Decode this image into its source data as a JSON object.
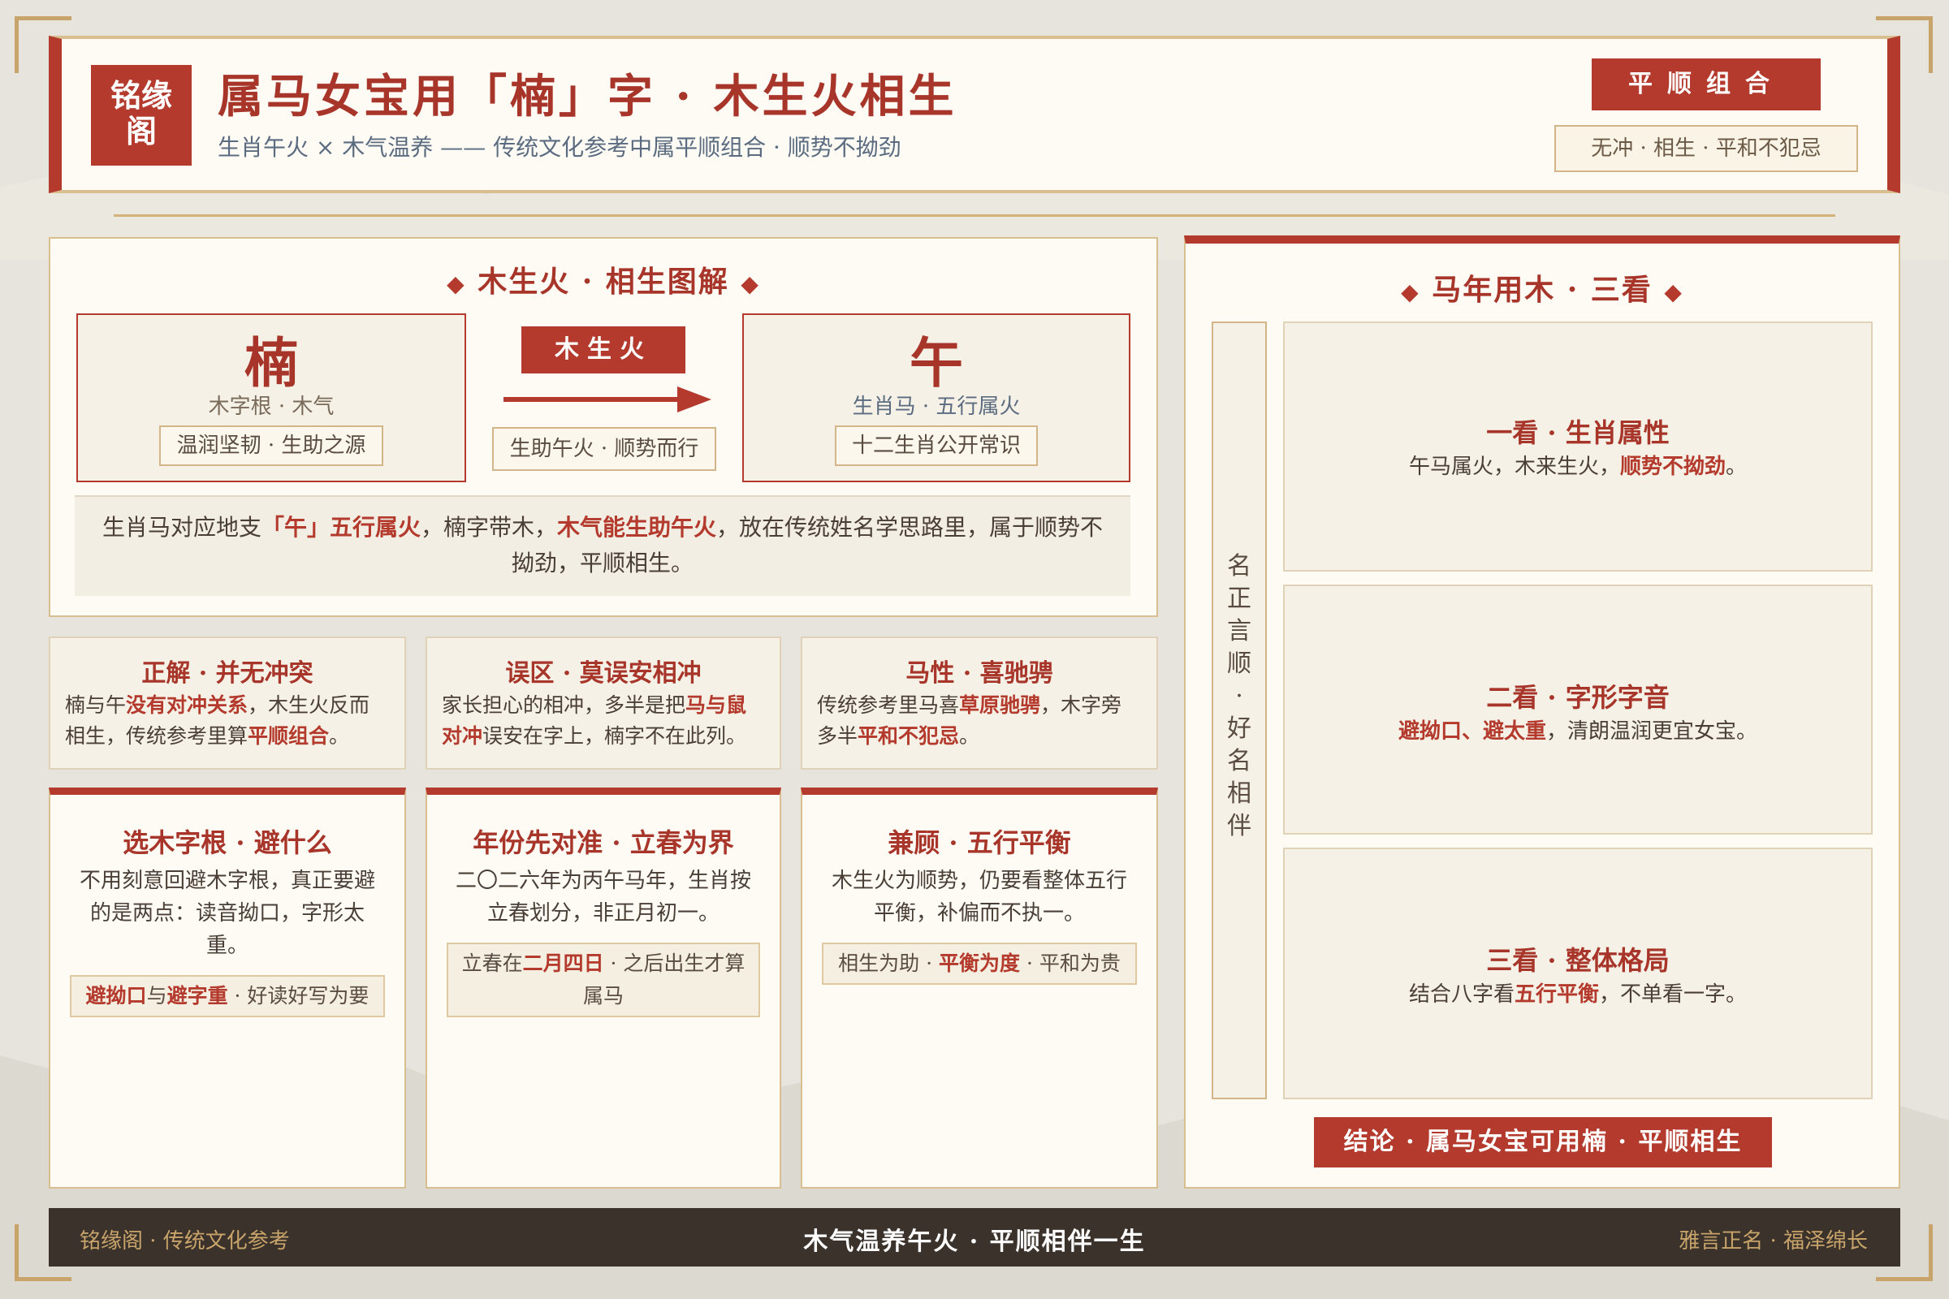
{
  "header": {
    "logo_line1": "铭缘",
    "logo_line2": "阁",
    "title": "属马女宝用「楠」字 · 木生火相生",
    "subtitle": "生肖午火 × 木气温养 —— 传统文化参考中属平顺组合 · 顺势不拗劲",
    "badge": "平顺组合",
    "tag": "无冲 · 相生 · 平和不犯忌"
  },
  "diagram": {
    "title": "木生火 · 相生图解",
    "left": {
      "char": "楠",
      "sub": "木字根 · 木气",
      "tag": "温润坚韧 · 生助之源"
    },
    "arrow": {
      "label": "木生火",
      "tag": "生助午火 · 顺势而行"
    },
    "right": {
      "char": "午",
      "sub": "生肖马 · 五行属火",
      "tag": "十二生肖公开常识"
    },
    "desc": {
      "p1": "生肖马对应地支",
      "h1": "「午」五行属火",
      "p2": "，楠字带木，",
      "h2": "木气能生助午火",
      "p3": "，放在传统姓名学思路里，属于顺势不拗劲，平顺相生。"
    }
  },
  "cards": [
    {
      "title": "正解 · 并无冲突",
      "t1": "楠与午",
      "h1": "没有对冲关系",
      "t2": "，木生火反而相生，传统参考里算",
      "h2": "平顺组合",
      "t3": "。"
    },
    {
      "title": "误区 · 莫误安相冲",
      "t1": "家长担心的相冲，多半是把",
      "h1": "马与鼠对冲",
      "t2": "误安在字上，楠字不在此列。",
      "h2": "",
      "t3": ""
    },
    {
      "title": "马性 · 喜驰骋",
      "t1": "传统参考里马喜",
      "h1": "草原驰骋",
      "t2": "，木字旁多半",
      "h2": "平和不犯忌",
      "t3": "。"
    }
  ],
  "tall_cards": [
    {
      "title": "选木字根 · 避什么",
      "text": "不用刻意回避木字根，真正要避的是两点：读音拗口，字形太重。",
      "tag_h1": "避拗口",
      "tag_p1": "与",
      "tag_h2": "避字重",
      "tag_p2": " · 好读好写为要"
    },
    {
      "title": "年份先对准 · 立春为界",
      "text": "二〇二六年为丙午马年，生肖按立春划分，非正月初一。",
      "tag_h1": "",
      "tag_p1": "立春在",
      "tag_h2": "二月四日",
      "tag_p2": " · 之后出生才算属马"
    },
    {
      "title": "兼顾 · 五行平衡",
      "text": "木生火为顺势，仍要看整体五行平衡，补偏而不执一。",
      "tag_h1": "",
      "tag_p1": "相生为助 · ",
      "tag_h2": "平衡为度",
      "tag_p2": " · 平和为贵"
    }
  ],
  "right": {
    "title": "马年用木 · 三看",
    "vertical": [
      "名",
      "正",
      "言",
      "顺",
      "·",
      "好",
      "名",
      "相",
      "伴"
    ],
    "items": [
      {
        "title": "一看 · 生肖属性",
        "t1": "午马属火，木来生火，",
        "h1": "顺势不拗劲",
        "t2": "。"
      },
      {
        "title": "二看 · 字形字音",
        "t1": "",
        "h1": "避拗口、避太重",
        "t2": "，清朗温润更宜女宝。"
      },
      {
        "title": "三看 · 整体格局",
        "t1": "结合八字看",
        "h1": "五行平衡",
        "t2": "，不单看一字。"
      }
    ],
    "conclusion": "结论 · 属马女宝可用楠 · 平顺相生"
  },
  "footer": {
    "left": "铭缘阁 · 传统文化参考",
    "center": "木气温养午火 · 平顺相伴一生",
    "right": "雅言正名 · 福泽绵长"
  },
  "colors": {
    "accent": "#b33a2c",
    "gold": "#c9a46a",
    "paper": "#fdfbf4",
    "dark": "#3a322b"
  }
}
